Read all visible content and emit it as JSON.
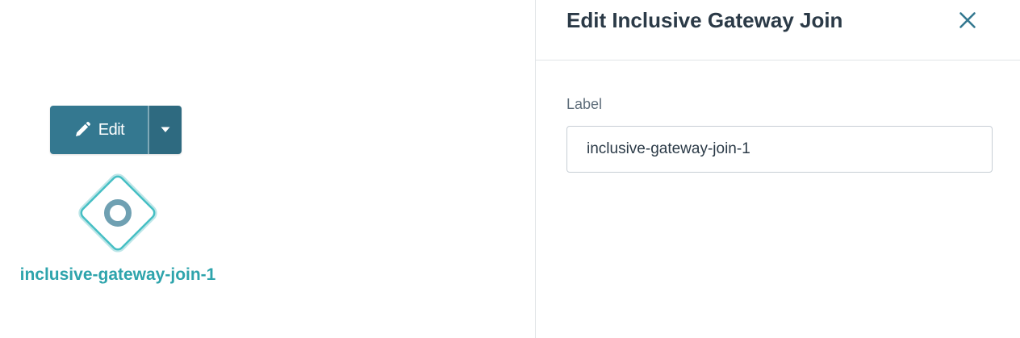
{
  "canvas": {
    "node": {
      "edit_button_label": "Edit",
      "edit_icon": "pencil-icon",
      "dropdown_icon": "caret-down-icon",
      "shape_icon": "inclusive-gateway-icon",
      "label": "inclusive-gateway-join-1"
    },
    "colors": {
      "button": "#347890",
      "button_dropdown": "#2e6a80",
      "gateway_stroke": "#46bfc4",
      "gateway_glow": "#bde6e8",
      "gateway_circle": "#6fa0b2",
      "node_label": "#2ea4ac"
    }
  },
  "panel": {
    "title": "Edit Inclusive Gateway Join",
    "close_icon": "close-icon",
    "fields": {
      "label_caption": "Label",
      "label_value": "inclusive-gateway-join-1"
    },
    "colors": {
      "title": "#2b3a47",
      "close": "#347890",
      "caption": "#5f6e7b"
    }
  }
}
